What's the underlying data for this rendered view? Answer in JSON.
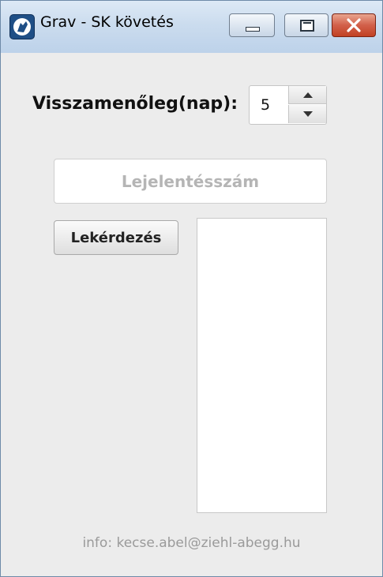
{
  "window": {
    "title": "Grav - SK követés",
    "icon": "app-logo-icon",
    "controls": [
      "minimize-icon",
      "maximize-icon",
      "close-icon"
    ]
  },
  "form": {
    "days_label": "Visszamenőleg(nap):",
    "days_value": "5",
    "report_number_placeholder": "Lejelentésszám",
    "report_number_value": "",
    "query_button_label": "Lekérdezés",
    "results": []
  },
  "footer": {
    "info_text": "info: kecse.abel@ziehl-abegg.hu"
  },
  "colors": {
    "close_button": "#c14123",
    "titlebar": "#cbdcee",
    "background": "#ececec"
  }
}
